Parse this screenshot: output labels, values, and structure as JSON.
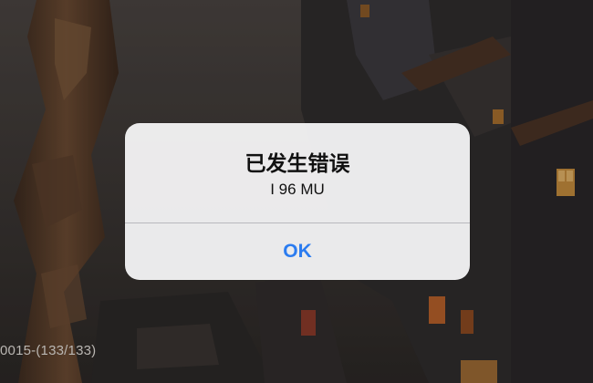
{
  "background": {
    "version_text": "0015-(133/133)"
  },
  "alert": {
    "title": "已发生错误",
    "message": "I 96 MU",
    "ok_label": "OK"
  },
  "colors": {
    "accent": "#2b7cf0",
    "alert_bg": "#f2f2f4",
    "scene_bg": "#3a3633"
  }
}
